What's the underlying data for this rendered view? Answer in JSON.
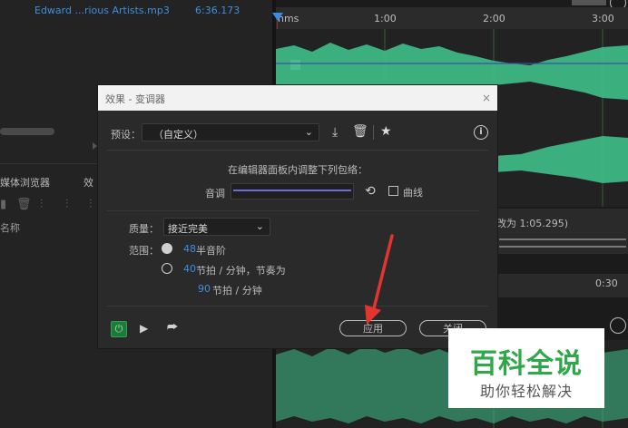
{
  "file_list": {
    "file_name": "Edward ...rious Artists.mp3",
    "duration": "6:36.173"
  },
  "left_panel": {
    "media_browser_tab": "媒体浏览器",
    "effects_tab": "效",
    "column_name": "名称"
  },
  "timeline": {
    "ruler_ticks": [
      "hms",
      "1:00",
      "2:00",
      "3:00"
    ],
    "overview_text": "改为 1:05.295)",
    "secondary_tick": "0:30"
  },
  "dialog": {
    "title": "效果 - 变调器",
    "close_glyph": "×",
    "preset_label": "预设：",
    "preset_value": "（自定义）",
    "instruction": "在编辑器面板内调整下列包络：",
    "pitch_label": "音调",
    "curve_label": "曲线",
    "quality_label": "质量：",
    "quality_value": "接近完美",
    "range_label": "范围：",
    "semitones_value": "48",
    "semitones_unit": "半音阶",
    "bpm_value": "40",
    "bpm_unit": "节拍 / 分钟，节奏为",
    "bpm2_value": "90",
    "bpm2_unit": "节拍 / 分钟",
    "apply_label": "应用",
    "close_label": "关闭",
    "info_glyph": "i"
  },
  "watermark": {
    "title": "百科全说",
    "subtitle": "助你轻松解决"
  },
  "icons": {
    "save_preset": "save-icon",
    "delete_preset": "trash-icon",
    "favorite": "star-icon",
    "info": "info-icon",
    "reset": "reset-icon",
    "power": "power-icon",
    "play": "play-icon",
    "export": "export-icon"
  },
  "colors": {
    "waveform": "#3fbf8a",
    "accent_blue": "#3d8fe0",
    "power_green": "#1f7a3a",
    "arrow_red": "#e3342f",
    "watermark_green": "#2fa84a"
  }
}
